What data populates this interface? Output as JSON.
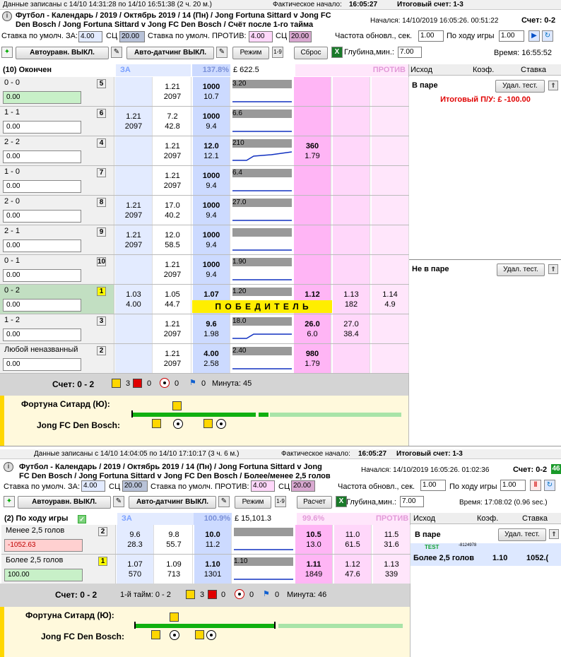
{
  "top": {
    "record_info": "Данные записаны с 14/10 14:31:28 по 14/10 16:51:38 (2 ч. 20 м.)",
    "actual_start_label": "Фактическое начало:",
    "actual_start": "16:05:27",
    "final_score": "Итоговый счет: 1-3",
    "title_line1": "Футбол - Календарь / 2019 / Октябрь 2019 / 14 (Пн) / Jong Fortuna Sittard v Jong FC",
    "title_line2": "Den Bosch / Jong Fortuna Sittard v Jong FC Den Bosch / Счёт после 1-го тайма",
    "started": "Начался: 14/10/2019 16:05:26. 00:51:22",
    "score_label": "Счет: 0-2",
    "back_stake_label": "Ставка по умолч. ЗА:",
    "back_stake": "4.00",
    "sc_label": "СЦ",
    "back_sc": "20.00",
    "lay_stake_label": "Ставка по умолч. ПРОТИВ:",
    "lay_stake": "4.00",
    "lay_sc": "20.00",
    "refresh_label": "Частота обновл., сек.",
    "refresh": "1.00",
    "inplay_label": "По ходу игры",
    "inplay": "1.00",
    "auto_eq": "Автоуравн. ВЫКЛ.",
    "auto_dating": "Авто-датчинг ВЫКЛ.",
    "mode": "Режим",
    "reset": "Сброс",
    "depth_label": "Глубина,мин.:",
    "depth": "7.00",
    "time": "Время: 16:55:52",
    "market_title": "(10) Окончен",
    "back_hdr": "ЗА",
    "back_pct": "137.8%",
    "matched": "£ 622.5",
    "lay_hdr": "ПРОТИВ",
    "col_outcome": "Исход",
    "col_odds": "Коэф.",
    "col_stake": "Ставка",
    "paired": "В паре",
    "del_test": "Удал. тест.",
    "total_pl": "Итоговый П/У: £ -100.00",
    "unpaired": "Не в паре",
    "winner_banner": "П О Б Е Д И Т Е Л Ь",
    "rows": [
      {
        "name": "0 - 0",
        "num": "5",
        "pl": "0.00",
        "b1": [
          "",
          ""
        ],
        "b2": [
          "1.21",
          "2097"
        ],
        "b3": [
          "1000",
          "10.7"
        ],
        "spark": "3.20",
        "l1": [
          "",
          ""
        ],
        "l2": [
          "",
          ""
        ],
        "l3": [
          "",
          ""
        ],
        "green": true
      },
      {
        "name": "1 - 1",
        "num": "6",
        "pl": "0.00",
        "b1": [
          "1.21",
          "2097"
        ],
        "b2": [
          "7.2",
          "42.8"
        ],
        "b3": [
          "1000",
          "9.4"
        ],
        "spark": "6.6",
        "l1": [
          "",
          ""
        ],
        "l2": [
          "",
          ""
        ],
        "l3": [
          "",
          ""
        ]
      },
      {
        "name": "2 - 2",
        "num": "4",
        "pl": "0.00",
        "b1": [
          "",
          ""
        ],
        "b2": [
          "1.21",
          "2097"
        ],
        "b3": [
          "12.0",
          "12.1"
        ],
        "spark": "210",
        "l1": [
          "360",
          "1.79"
        ],
        "l2": [
          "",
          ""
        ],
        "l3": [
          "",
          ""
        ]
      },
      {
        "name": "1 - 0",
        "num": "7",
        "pl": "0.00",
        "b1": [
          "",
          ""
        ],
        "b2": [
          "1.21",
          "2097"
        ],
        "b3": [
          "1000",
          "9.4"
        ],
        "spark": "6.4",
        "l1": [
          "",
          ""
        ],
        "l2": [
          "",
          ""
        ],
        "l3": [
          "",
          ""
        ]
      },
      {
        "name": "2 - 0",
        "num": "8",
        "pl": "0.00",
        "b1": [
          "1.21",
          "2097"
        ],
        "b2": [
          "17.0",
          "40.2"
        ],
        "b3": [
          "1000",
          "9.4"
        ],
        "spark": "27.0",
        "l1": [
          "",
          ""
        ],
        "l2": [
          "",
          ""
        ],
        "l3": [
          "",
          ""
        ]
      },
      {
        "name": "2 - 1",
        "num": "9",
        "pl": "0.00",
        "b1": [
          "1.21",
          "2097"
        ],
        "b2": [
          "12.0",
          "58.5"
        ],
        "b3": [
          "1000",
          "9.4"
        ],
        "spark": "",
        "l1": [
          "",
          ""
        ],
        "l2": [
          "",
          ""
        ],
        "l3": [
          "",
          ""
        ]
      },
      {
        "name": "0 - 1",
        "num": "10",
        "pl": "0.00",
        "b1": [
          "",
          ""
        ],
        "b2": [
          "1.21",
          "2097"
        ],
        "b3": [
          "1000",
          "9.4"
        ],
        "spark": "1.90",
        "l1": [
          "",
          ""
        ],
        "l2": [
          "",
          ""
        ],
        "l3": [
          "",
          ""
        ]
      },
      {
        "name": "0 - 2",
        "num": "1",
        "pl": "0.00",
        "b1": [
          "1.03",
          "4.00"
        ],
        "b2": [
          "1.05",
          "44.7"
        ],
        "b3": [
          "1.07",
          ""
        ],
        "spark": "1.20",
        "l1": [
          "1.12",
          ""
        ],
        "l2": [
          "1.13",
          "182"
        ],
        "l3": [
          "1.14",
          "4.9"
        ],
        "winner": true
      },
      {
        "name": "1 - 2",
        "num": "3",
        "pl": "0.00",
        "b1": [
          "",
          ""
        ],
        "b2": [
          "1.21",
          "2097"
        ],
        "b3": [
          "9.6",
          "1.98"
        ],
        "spark": "18.0",
        "l1": [
          "26.0",
          "6.0"
        ],
        "l2": [
          "27.0",
          "38.4"
        ],
        "l3": [
          "",
          ""
        ]
      },
      {
        "name": "Любой неназванный",
        "num": "2",
        "pl": "0.00",
        "b1": [
          "",
          ""
        ],
        "b2": [
          "1.21",
          "2097"
        ],
        "b3": [
          "4.00",
          "2.58"
        ],
        "spark": "2.40",
        "l1": [
          "980",
          "1.79"
        ],
        "l2": [
          "",
          ""
        ],
        "l3": [
          "",
          ""
        ]
      }
    ],
    "score_text": "Счет: 0 - 2",
    "yellow": "3",
    "red": "0",
    "goals_ball": "0",
    "corners": "0",
    "minute": "Минута: 45",
    "home_team": "Фортуна Ситард (Ю):",
    "away_team": "Jong FC Den Bosch:"
  },
  "bottom": {
    "record_info": "Данные записаны с 14/10 14:04:05 по 14/10 17:10:17 (3 ч. 6 м.)",
    "actual_start_label": "Фактическое начало:",
    "actual_start": "16:05:27",
    "final_score": "Итоговый счет: 1-3",
    "title_line1": "Футбол - Календарь / 2019 / Октябрь 2019 / 14 (Пн) / Jong Fortuna Sittard v Jong",
    "title_line2": "FC Den Bosch / Jong Fortuna Sittard v Jong FC Den Bosch / Более/менее 2,5 голов",
    "started": "Начался: 14/10/2019 16:05:26. 01:02:36",
    "score_label": "Счет: 0-2",
    "score_badge": "46",
    "back_stake_label": "Ставка по умолч. ЗА:",
    "back_stake": "4.00",
    "sc_label": "СЦ",
    "back_sc": "20.00",
    "lay_stake_label": "Ставка по умолч. ПРОТИВ:",
    "lay_stake": "4.00",
    "lay_sc": "20.00",
    "refresh_label": "Частота обновл., сек.",
    "refresh": "1.00",
    "inplay_label": "По ходу игры",
    "inplay": "1.00",
    "auto_eq": "Автоуравн. ВЫКЛ.",
    "auto_dating": "Авто-датчинг ВЫКЛ.",
    "mode": "Режим",
    "calc": "Расчет",
    "depth_label": "Глубина,мин.:",
    "depth": "7.00",
    "time": "Время: 17:08:02 (0.96 sec.)",
    "market_title": "(2) По ходу игры",
    "back_hdr": "ЗА",
    "back_pct": "100.9%",
    "matched": "£ 15,101.3",
    "lay_pct": "99.6%",
    "lay_hdr": "ПРОТИВ",
    "col_outcome": "Исход",
    "col_odds": "Коэф.",
    "col_stake": "Ставка",
    "paired": "В паре",
    "del_test": "Удал. тест.",
    "test_tag": "TEST",
    "test_id": "-8124978",
    "bet_name": "Более 2,5 голов",
    "bet_odds": "1.10",
    "bet_stake": "1052.(",
    "rows": [
      {
        "name": "Менее 2,5 голов",
        "num": "2",
        "pl": "-1052.63",
        "b1": [
          "9.6",
          "28.3"
        ],
        "b2": [
          "9.8",
          "55.7"
        ],
        "b3": [
          "10.0",
          "11.2"
        ],
        "spark": "",
        "l1": [
          "10.5",
          "13.0"
        ],
        "l2": [
          "11.0",
          "61.5"
        ],
        "l3": [
          "11.5",
          "31.6"
        ],
        "neg": true
      },
      {
        "name": "Более 2,5 голов",
        "num": "1",
        "pl": "100.00",
        "b1": [
          "1.07",
          "570"
        ],
        "b2": [
          "1.09",
          "713"
        ],
        "b3": [
          "1.10",
          "1301"
        ],
        "spark": "1.10",
        "l1": [
          "1.11",
          "1849"
        ],
        "l2": [
          "1.12",
          "47.6"
        ],
        "l3": [
          "1.13",
          "339"
        ],
        "green": true
      }
    ],
    "score_text": "Счет: 0 - 2",
    "half_text": "1-й тайм: 0 - 2",
    "yellow": "3",
    "red": "0",
    "goals_ball": "0",
    "corners": "0",
    "minute": "Минута: 46",
    "home_team": "Фортуна Ситард (Ю):",
    "away_team": "Jong FC Den Bosch:"
  }
}
